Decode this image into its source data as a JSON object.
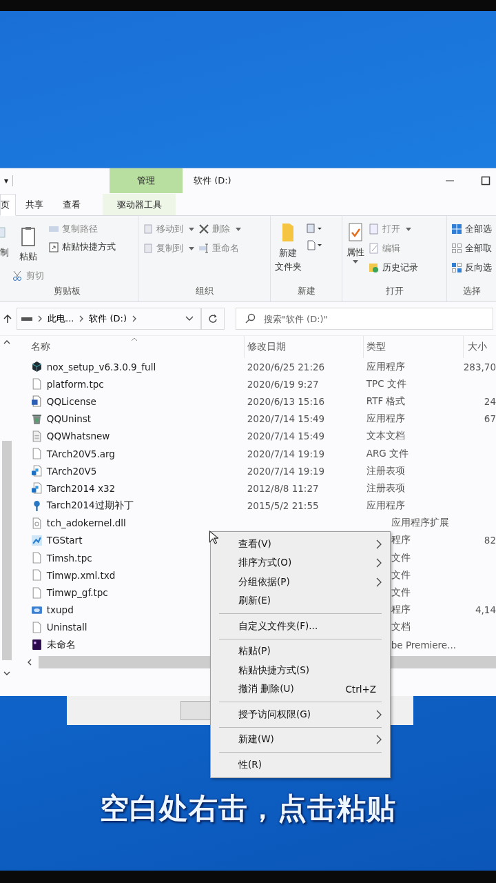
{
  "window": {
    "contextual_tab": "管理",
    "title": "软件 (D:)",
    "quick_access": "▾"
  },
  "tabs": [
    {
      "label": "页",
      "selected": true
    },
    {
      "label": "共享",
      "selected": false
    },
    {
      "label": "查看",
      "selected": false
    },
    {
      "label": "驱动器工具",
      "selected": false
    }
  ],
  "ribbon": {
    "clipboard": {
      "copy": "制",
      "paste": "粘贴",
      "copy_path": "复制路径",
      "paste_shortcut": "粘贴快捷方式",
      "cut": "剪切",
      "group": "剪贴板"
    },
    "organize": {
      "move_to": "移动到",
      "copy_to": "复制到",
      "delete": "删除",
      "rename": "重命名",
      "group": "组织"
    },
    "new": {
      "new_folder": [
        "新建",
        "文件夹"
      ],
      "group": "新建"
    },
    "open": {
      "properties": "属性",
      "open": "打开",
      "edit": "编辑",
      "history": "历史记录",
      "group": "打开"
    },
    "select": {
      "select_all": "全部选",
      "select_none": "全部取",
      "invert": "反向选",
      "group": "选择"
    }
  },
  "address_bar": {
    "crumbs": [
      "此电...",
      "软件 (D:)"
    ]
  },
  "search": {
    "placeholder": "搜索\"软件 (D:)\""
  },
  "columns": [
    "名称",
    "修改日期",
    "类型",
    "大小"
  ],
  "files": [
    {
      "kind": "app",
      "name": "nox_setup_v6.3.0.9_full",
      "date": "2020/6/25 21:26",
      "type": "应用程序",
      "size": "283,70"
    },
    {
      "kind": "blank",
      "name": "platform.tpc",
      "date": "2020/6/19 9:27",
      "type": "TPC 文件"
    },
    {
      "kind": "rtf",
      "name": "QQLicense",
      "date": "2020/6/13 15:16",
      "type": "RTF 格式",
      "size": "24"
    },
    {
      "kind": "uninst",
      "name": "QQUninst",
      "date": "2020/7/14 15:49",
      "type": "应用程序",
      "size": "67"
    },
    {
      "kind": "text",
      "name": "QQWhatsnew",
      "date": "2020/7/14 15:49",
      "type": "文本文档"
    },
    {
      "kind": "blank",
      "name": "TArch20V5.arg",
      "date": "2020/7/14 19:19",
      "type": "ARG 文件"
    },
    {
      "kind": "reg",
      "name": "TArch20V5",
      "date": "2020/7/14 19:19",
      "type": "注册表项"
    },
    {
      "kind": "reg",
      "name": "Tarch2014 x32",
      "date": "2012/8/8 11:27",
      "type": "注册表项"
    },
    {
      "kind": "patch",
      "name": "Tarch2014过期补丁",
      "date": "2015/5/2 21:55",
      "type": "应用程序"
    },
    {
      "kind": "dll",
      "name": "tch_adokernel.dll",
      "type": "应用程序扩展"
    },
    {
      "kind": "tg",
      "name": "TGStart",
      "type": "程序",
      "size": "82"
    },
    {
      "kind": "blank",
      "name": "Timsh.tpc",
      "type": "文件"
    },
    {
      "kind": "blank",
      "name": "Timwp.xml.txd",
      "type": "文件"
    },
    {
      "kind": "blank",
      "name": "Timwp_gf.tpc",
      "type": "文件"
    },
    {
      "kind": "tx",
      "name": "txupd",
      "type": "程序",
      "size": "4,14"
    },
    {
      "kind": "blank",
      "name": "Uninstall",
      "type": "文档"
    },
    {
      "kind": "premiere",
      "name": "未命名",
      "type": "be Premiere..."
    }
  ],
  "context_menu": [
    {
      "kind": "item",
      "label": "查看(V)",
      "submenu": true
    },
    {
      "kind": "item",
      "label": "排序方式(O)",
      "submenu": true
    },
    {
      "kind": "item",
      "label": "分组依据(P)",
      "submenu": true
    },
    {
      "kind": "item",
      "label": "刷新(E)",
      "submenu": false
    },
    {
      "kind": "separator"
    },
    {
      "kind": "item",
      "label": "自定义文件夹(F)...",
      "submenu": false
    },
    {
      "kind": "separator"
    },
    {
      "kind": "item",
      "label": "粘贴(P)",
      "submenu": false
    },
    {
      "kind": "item",
      "label": "粘贴快捷方式(S)",
      "submenu": false
    },
    {
      "kind": "item",
      "label": "撤消 删除(U)",
      "shortcut": "Ctrl+Z",
      "submenu": false
    },
    {
      "kind": "separator"
    },
    {
      "kind": "item",
      "label": "授予访问权限(G)",
      "submenu": true
    },
    {
      "kind": "separator"
    },
    {
      "kind": "item",
      "label": "新建(W)",
      "submenu": true
    },
    {
      "kind": "separator"
    },
    {
      "kind": "item",
      "label": "性(R)",
      "submenu": false
    }
  ],
  "caption": "空白处右击，点击粘贴"
}
